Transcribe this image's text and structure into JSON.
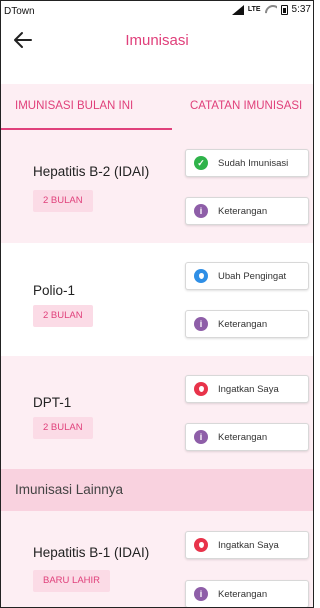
{
  "status": {
    "carrier": "DTown",
    "network": "LTE",
    "time": "5:37"
  },
  "header": {
    "title": "Imunisasi"
  },
  "tabs": [
    {
      "label": "IMUNISASI BULAN INI"
    },
    {
      "label": "CATATAN IMUNISASI"
    }
  ],
  "vaccines": [
    {
      "name": "Hepatitis B-2 (IDAI)",
      "age": "2 BULAN",
      "status_label": "Sudah Imunisasi",
      "info_label": "Keterangan"
    },
    {
      "name": "Polio-1",
      "age": "2 BULAN",
      "status_label": "Ubah Pengingat",
      "info_label": "Keterangan"
    },
    {
      "name": "DPT-1",
      "age": "2 BULAN",
      "status_label": "Ingatkan Saya",
      "info_label": "Keterangan"
    }
  ],
  "other": {
    "header": "Imunisasi Lainnya",
    "items": [
      {
        "name": "Hepatitis B-1 (IDAI)",
        "age": "BARU LAHIR",
        "status_label": "Ingatkan Saya",
        "info_label": "Keterangan"
      }
    ]
  },
  "colors": {
    "accent": "#e0407b",
    "done": "#2fb34a",
    "info": "#8e5ea8",
    "edit": "#2f8fe6",
    "remind": "#e8334a"
  }
}
